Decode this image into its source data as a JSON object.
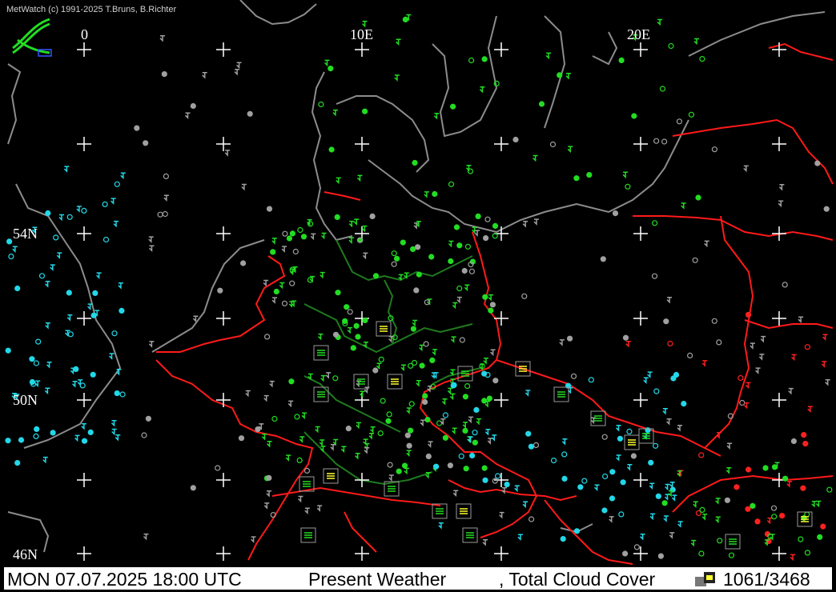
{
  "credit": "MetWatch  (c) 1991-2025 T.Bruns, B.Richter",
  "grid_labels": {
    "lon_0": "0",
    "lon_10e": "10E",
    "lon_20e": "20E",
    "lat_54n": "54N",
    "lat_50n": "50N",
    "lat_46n": "46N"
  },
  "status": {
    "datetime": "MON 07.07.2025 18:00 UTC",
    "product": "Present Weather",
    "overlay": ", Total Cloud Cover",
    "count": "1061/3468"
  },
  "colors": {
    "background": "#000000",
    "coastline": "#8c8c8c",
    "border": "#ff1a1a",
    "state_border": "#1f7a1f",
    "grid": "#ffffff",
    "weather_green": "#22dd22",
    "weather_red": "#ff2020",
    "cloud_cyan": "#22d8e8",
    "cloud_gray": "#a0a0a0",
    "yellow": "#ffff33"
  },
  "icons": {
    "logo": "metwatch-logo-icon",
    "legend": "legend-icon"
  }
}
